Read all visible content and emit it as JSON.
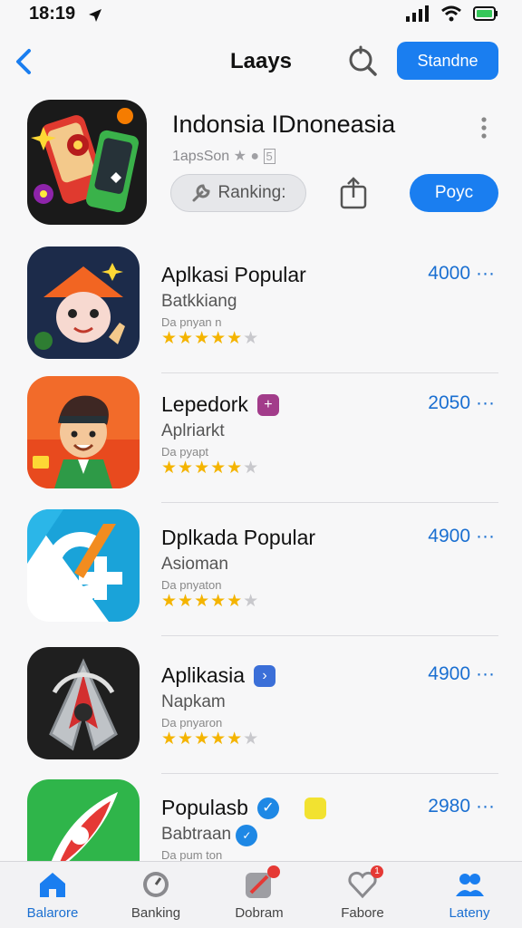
{
  "status": {
    "time": "18:19"
  },
  "nav": {
    "title": "Laays",
    "action_label": "Standne"
  },
  "featured": {
    "title": "Indonsia IDnoneasia",
    "subtitle": "1apsSon",
    "rank_label": "Ranking:",
    "get_label": "Poyc"
  },
  "apps": [
    {
      "name": "Aplkasi Popular",
      "subtitle": "Batkkiang",
      "meta": "Da pnyan n",
      "count": "4000",
      "rating": 4.5
    },
    {
      "name": "Lepedork",
      "subtitle": "Aplriarkt",
      "meta": "Da pyapt",
      "count": "2050",
      "rating": 4.5
    },
    {
      "name": "Dplkada Popular",
      "subtitle": "Asioman",
      "meta": "Da pnyaton",
      "count": "4900",
      "rating": 4.5
    },
    {
      "name": "Aplikasia",
      "subtitle": "Napkam",
      "meta": "Da pnyaron",
      "count": "4900",
      "rating": 4.5
    },
    {
      "name": "Populasb",
      "subtitle": "Babtraan",
      "meta": "Da pum ton",
      "count": "2980",
      "rating": 4.5
    }
  ],
  "tabs": [
    {
      "label": "Balarore",
      "icon": "home-icon",
      "active": true
    },
    {
      "label": "Banking",
      "icon": "clock-icon",
      "active": false
    },
    {
      "label": "Dobram",
      "icon": "rocket-icon",
      "active": false
    },
    {
      "label": "Fabore",
      "icon": "heart-icon",
      "active": false,
      "badge": "1"
    },
    {
      "label": "Lateny",
      "icon": "people-icon",
      "active": true
    }
  ],
  "colors": {
    "accent": "#1a7ef0",
    "star": "#f4b400",
    "link": "#1a6fd1"
  }
}
